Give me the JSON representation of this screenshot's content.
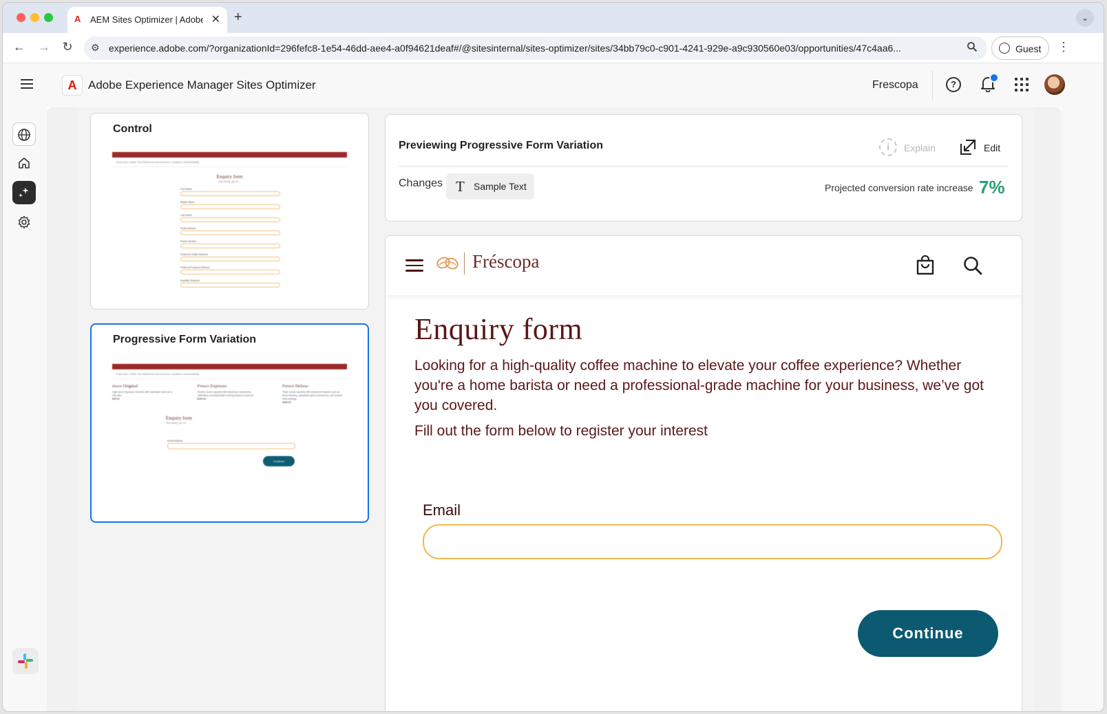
{
  "browser": {
    "tab_title": "AEM Sites Optimizer | Adobe Experience Manager",
    "tab_close": "✕",
    "new_tab": "+",
    "url": "experience.adobe.com/?organizationId=296fefc8-1e54-46dd-aee4-a0f94621deaf#/@sitesinternal/sites-optimizer/sites/34bb79c0-c901-4241-929e-a9c930560e03/opportunities/47c4aa6...",
    "profile_label": "Guest"
  },
  "app": {
    "name": "Adobe Experience Manager Sites Optimizer",
    "org": "Frescopa"
  },
  "rail": {
    "icons": [
      "globe-icon",
      "home-icon",
      "opportunities-icon",
      "settings-icon",
      "slack-icon"
    ]
  },
  "variations": [
    {
      "title": "Control",
      "thumb": {
        "banner": "FREE SHIPPING FROM $50 & FREE COFFEE SAMPLES WITH EVERY PURCHASE",
        "nav": "Frescopa   Coffee   Tea   Machines   Accessories   Locations   Sustainability",
        "heading": "Enquiry form",
        "sub": "Ask away, go on...",
        "fields": [
          "First Name",
          "Middle Name",
          "Last Name",
          "Email Address",
          "Phone Number",
          "Preferred Coffee Machine",
          "Preferred Payment Method",
          "Quantity Required"
        ]
      }
    },
    {
      "title": "Progressive Form Variation",
      "thumb": {
        "banner": "SHOPPING FROM $50 & FREE COFFEE SAMPLES WITH CODE FRESCOPA",
        "nav": "Frescopa   Coffee   Tea   Machines   Accessories   Locations   Sustainability",
        "products": [
          {
            "name": "resco Original",
            "desc": "ingle-serve espresso machine with washable reservoir & drip dish.",
            "price": "$99.00"
          },
          {
            "name": "Fresco Expresso",
            "desc": "Double nozzle capacity with advanced coarseness calibration and detachable frothing wheat & reservoir.",
            "price": "$299.00"
          },
          {
            "name": "Fresco Deluxe",
            "desc": "Triple nozzle capacity with advanced features such as timed brewing, adjustable grind coarseness, and custom drink settings.",
            "price": "$499.00"
          }
        ],
        "heading": "Enquiry form",
        "sub": "Ask away, go on...",
        "field": "Email Address",
        "button": "Continue"
      }
    }
  ],
  "preview_header": {
    "title": "Previewing Progressive Form Variation",
    "explain_label": "Explain",
    "edit_label": "Edit",
    "changes_label": "Changes",
    "change_chip": "Sample Text",
    "projection_label": "Projected conversion rate increase",
    "projection_value": "7%",
    "projection_color": "#2d9d78"
  },
  "site": {
    "brand": "Fréscopa",
    "form_title": "Enquiry form",
    "intro": "Looking for a high-quality coffee machine to elevate your coffee experience? Whether you're a home barista or need a professional-grade machine for your business, we’ve got you covered.",
    "cta": "Fill out the form below to register your interest",
    "email_label": "Email",
    "email_value": "",
    "continue_label": "Continue",
    "brand_color": "#5b1717",
    "button_color": "#0c5a72",
    "input_border_color": "#f3b94f"
  }
}
